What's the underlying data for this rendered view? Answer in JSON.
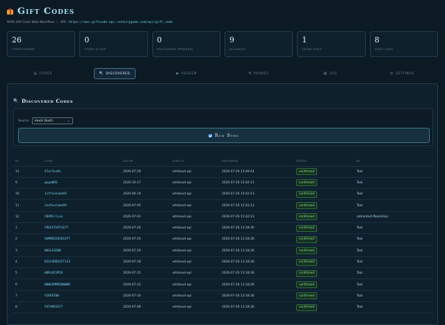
{
  "header": {
    "title": "Gift Codes",
    "subtitle_prefix": "WOS Gift Code Web Workflow —",
    "api_label": "API:",
    "api_url": "https://wos-giftcode-api.centurygame.com/api/gift_code",
    "icon": "gift-icon",
    "accent_color": "#9fe3f3"
  },
  "stats": [
    {
      "value": "26",
      "label": "Codes Known"
    },
    {
      "value": "0",
      "label": "Codes Active"
    },
    {
      "value": "0",
      "label": "Discovered (pending)"
    },
    {
      "value": "9",
      "label": "Alliances"
    },
    {
      "value": "1",
      "label": "Cache Stale"
    },
    {
      "value": "8",
      "label": "Audit (24h)"
    }
  ],
  "tabs": [
    {
      "label": "Codes",
      "icon": "list-icon"
    },
    {
      "label": "Discovered",
      "icon": "search-icon"
    },
    {
      "label": "Redeem",
      "icon": "play-icon"
    },
    {
      "label": "Probes",
      "icon": "probe-icon"
    },
    {
      "label": "Log",
      "icon": "document-icon"
    },
    {
      "label": "Settings",
      "icon": "gear-icon"
    }
  ],
  "active_tab": "Discovered",
  "panel": {
    "title": "Discovered Codes",
    "source_label": "Source:",
    "source_value": "mock (test)",
    "run_label": "Run Sync"
  },
  "table": {
    "columns": [
      "ID",
      "Code",
      "Datum",
      "Quelle",
      "Gefunden",
      "Status",
      "By"
    ],
    "rows": [
      [
        "13",
        "47arSvzKz",
        "2026-07-29",
        "whiteout-api",
        "2026-07-29 12:49:44",
        "confirmed",
        "Tool"
      ],
      [
        "9",
        "gogoWOS",
        "2026-10-17",
        "whiteout-api",
        "2026-07-26 15:42:13",
        "confirmed",
        "Tool"
      ],
      [
        "10",
        "1stYoutube69",
        "2026-06-19",
        "whiteout-api",
        "2026-07-26 15:42:13",
        "confirmed",
        "Tool"
      ],
      [
        "11",
        "2ndYoutube69",
        "2026-07-05",
        "whiteout-api",
        "2026-07-26 15:42:13",
        "confirmed",
        "Tool"
      ],
      [
        "12",
        "FBAMillion",
        "2026-07-03",
        "whiteout-api",
        "2026-07-26 15:42:13",
        "confirmed",
        "admintest-fbamillion"
      ],
      [
        "1",
        "FREESTUFFGIFT",
        "2026-07-26",
        "whiteout-api",
        "2026-07-26 13:18:36",
        "confirmed",
        "Tool"
      ],
      [
        "2",
        "SUMMER2026GIFT",
        "2026-07-25",
        "whiteout-api",
        "2026-07-26 13:18:36",
        "confirmed",
        "Tool"
      ],
      [
        "3",
        "WOSLEGEND",
        "2026-07-20",
        "whiteout-api",
        "2026-07-26 13:18:36",
        "confirmed",
        "Tool"
      ],
      [
        "4",
        "DISCORDGIFT123",
        "2026-07-18",
        "whiteout-api",
        "2026-07-26 13:18:36",
        "confirmed",
        "Tool"
      ],
      [
        "5",
        "WORLDCUP26",
        "2026-07-15",
        "whiteout-api",
        "2026-07-26 13:18:36",
        "confirmed",
        "Tool"
      ],
      [
        "6",
        "WOWSUMMER8WW8D",
        "2026-07-12",
        "whiteout-api",
        "2026-07-26 13:18:36",
        "confirmed",
        "Tool"
      ],
      [
        "7",
        "FIREKING",
        "2026-07-10",
        "whiteout-api",
        "2026-07-26 13:18:36",
        "confirmed",
        "Tool"
      ],
      [
        "8",
        "FUTUREGIFT",
        "2026-07-08",
        "whiteout-api",
        "2026-07-26 13:18:36",
        "confirmed",
        "Tool"
      ]
    ]
  }
}
